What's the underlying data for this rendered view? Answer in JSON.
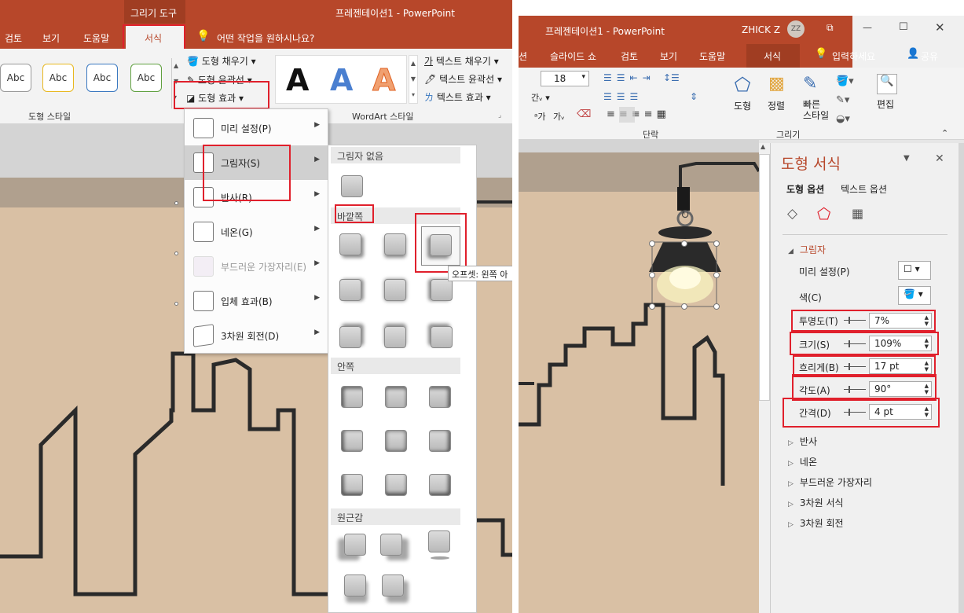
{
  "left": {
    "contextual_tab": "그리기 도구",
    "window_title": "프레젠테이션1  -  PowerPoint",
    "tabs": [
      "검토",
      "보기",
      "도움말",
      "서식"
    ],
    "active_tab": "서식",
    "tell_me": "어떤 작업을 원하시나요?",
    "shape_styles": [
      "Abc",
      "Abc",
      "Abc",
      "Abc"
    ],
    "shape_fill": "도형 채우기",
    "shape_outline": "도형 윤곽선",
    "shape_effects": "도형 효과",
    "group_shape_styles": "도형 스타일",
    "group_wordart": "WordArt 스타일",
    "wordart_letters": [
      "A",
      "A",
      "A"
    ],
    "text_fill": "텍스트 채우기",
    "text_outline": "텍스트 윤곽선",
    "text_effects": "텍스트 효과",
    "text_fill_icon_char": "가",
    "menu_items": [
      "미리 설정(P)",
      "그림자(S)",
      "반사(R)",
      "네온(G)",
      "부드러운 가장자리(E)",
      "입체 효과(B)",
      "3차원 회전(D)"
    ],
    "shadow_submenu": {
      "no_shadow": "그림자 없음",
      "outer": "바깥쪽",
      "inner": "안쪽",
      "perspective": "원근감",
      "tooltip": "오프셋: 왼쪽 아"
    },
    "colors": {
      "accent": "#b7472a",
      "highlight": "#e0202c",
      "canvas": "#d9c0a4"
    }
  },
  "right": {
    "window_title": "프레젠테이션1  -  PowerPoint",
    "user_name": "ZHICK Z",
    "avatar_initials": "ZZ",
    "tabs": [
      "션",
      "슬라이드 쇼",
      "검토",
      "보기",
      "도움말",
      "서식"
    ],
    "active_tab": "서식",
    "tell_me": "입력하세요",
    "share": "공유",
    "font_size": "18",
    "font_size_labels": [
      "가",
      "가"
    ],
    "char_spacing": "간",
    "group_paragraph": "단락",
    "group_drawing": "그리기",
    "group_edit": "편집",
    "draw_buttons": [
      "도형",
      "정렬",
      "빠른\n스타일"
    ],
    "edit_button": "편집",
    "format_pane": {
      "title": "도형 서식",
      "tabs": [
        "도형 옵션",
        "텍스트 옵션"
      ],
      "section_shadow": "그림자",
      "preset_label": "미리 설정(P)",
      "color_label": "색(C)",
      "transparency_label": "투명도(T)",
      "transparency": "7%",
      "size_label": "크기(S)",
      "size": "109%",
      "blur_label": "흐리게(B)",
      "blur": "17 pt",
      "angle_label": "각도(A)",
      "angle": "90°",
      "distance_label": "간격(D)",
      "distance": "4 pt",
      "other_sections": [
        "반사",
        "네온",
        "부드러운 가장자리",
        "3차원 서식",
        "3차원 회전"
      ]
    }
  }
}
